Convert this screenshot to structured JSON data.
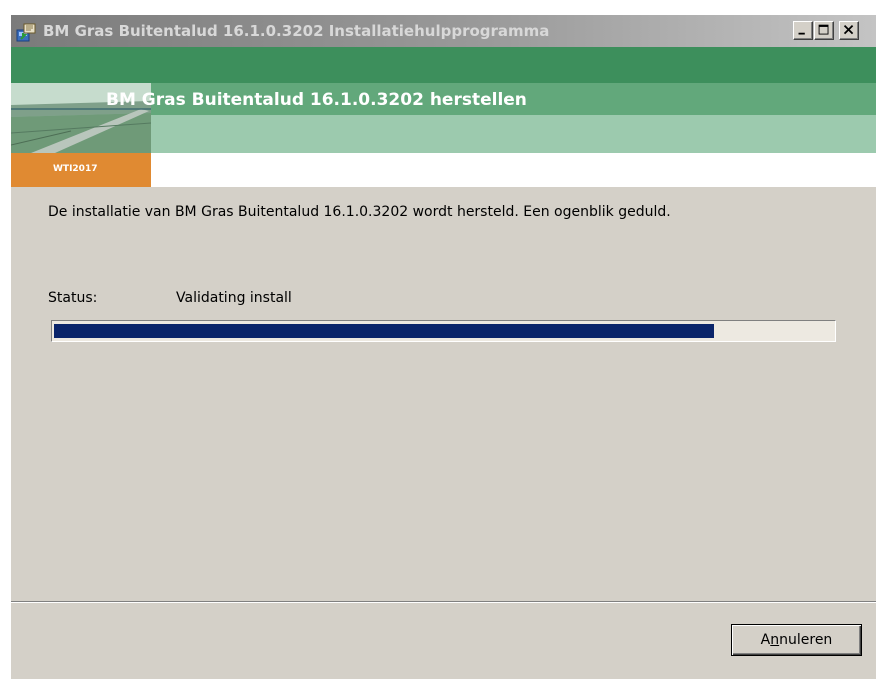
{
  "window": {
    "title": "BM Gras Buitentalud 16.1.0.3202 Installatiehulpprogramma",
    "icon": "installer-icon"
  },
  "titlebar_buttons": {
    "minimize": "minimize-icon",
    "maximize": "maximize-icon",
    "close": "close-icon"
  },
  "banner": {
    "title": "BM Gras Buitentalud 16.1.0.3202 herstellen",
    "badge": "WTI2017",
    "colors": {
      "dark_green": "#3d8f5c",
      "mid_green": "#62a87b",
      "light_green": "#9ccaae",
      "badge_orange": "#e08a32"
    }
  },
  "body": {
    "message": "De installatie van BM Gras Buitentalud 16.1.0.3202 wordt hersteld. Een ogenblik geduld.",
    "status_label": "Status:",
    "status_value": "Validating install"
  },
  "progress": {
    "percent": 85,
    "fill_color": "#0a246a"
  },
  "buttons": {
    "cancel_prefix": "A",
    "cancel_mnemonic": "n",
    "cancel_suffix": "nuleren"
  }
}
